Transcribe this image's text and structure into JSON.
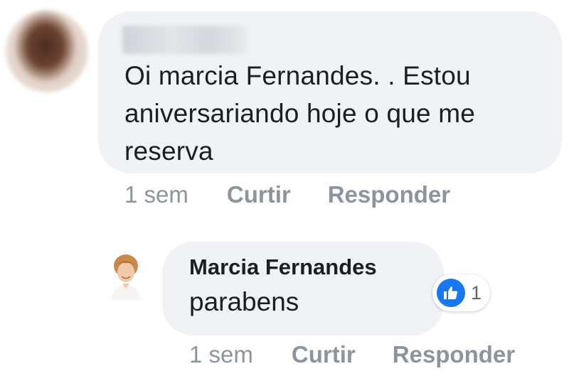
{
  "comment": {
    "author": "",
    "text": "Oi marcia Fernandes. . Estou aniversariando hoje o que me reserva",
    "time": "1 sem",
    "like_label": "Curtir",
    "reply_label": "Responder"
  },
  "reply": {
    "author": "Marcia Fernandes",
    "text": "parabens",
    "reaction_icon": "thumbs-up-icon",
    "reaction_count": "1",
    "time": "1 sem",
    "like_label": "Curtir",
    "reply_label": "Responder"
  },
  "colors": {
    "bubble": "#f0f2f5",
    "meta_text": "#8d949e",
    "like_blue": "#1877f2"
  }
}
